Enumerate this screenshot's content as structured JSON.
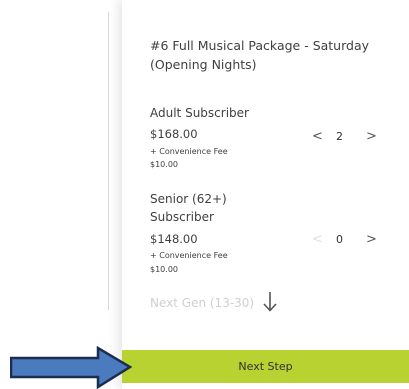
{
  "package": {
    "title": "#6 Full Musical Package - Saturday (Opening Nights)"
  },
  "tickets": [
    {
      "name": "Adult Subscriber",
      "price": "$168.00",
      "fee_label": "+ Convenience Fee",
      "fee_amount": "$10.00",
      "quantity": "2"
    },
    {
      "name": "Senior (62+) Subscriber",
      "price": "$148.00",
      "fee_label": "+ Convenience Fee",
      "fee_amount": "$10.00",
      "quantity": "0"
    },
    {
      "name": "Next Gen (13-30)"
    }
  ],
  "stepper": {
    "decrement_glyph": "<",
    "increment_glyph": ">"
  },
  "next_step_label": "Next Step",
  "colors": {
    "accent": "#b8d232",
    "arrow_fill": "#4a7bbf",
    "arrow_stroke": "#1d2d4f"
  },
  "icons": {
    "scroll_hint": "arrow-down-icon",
    "pointer": "arrow-right-icon"
  }
}
